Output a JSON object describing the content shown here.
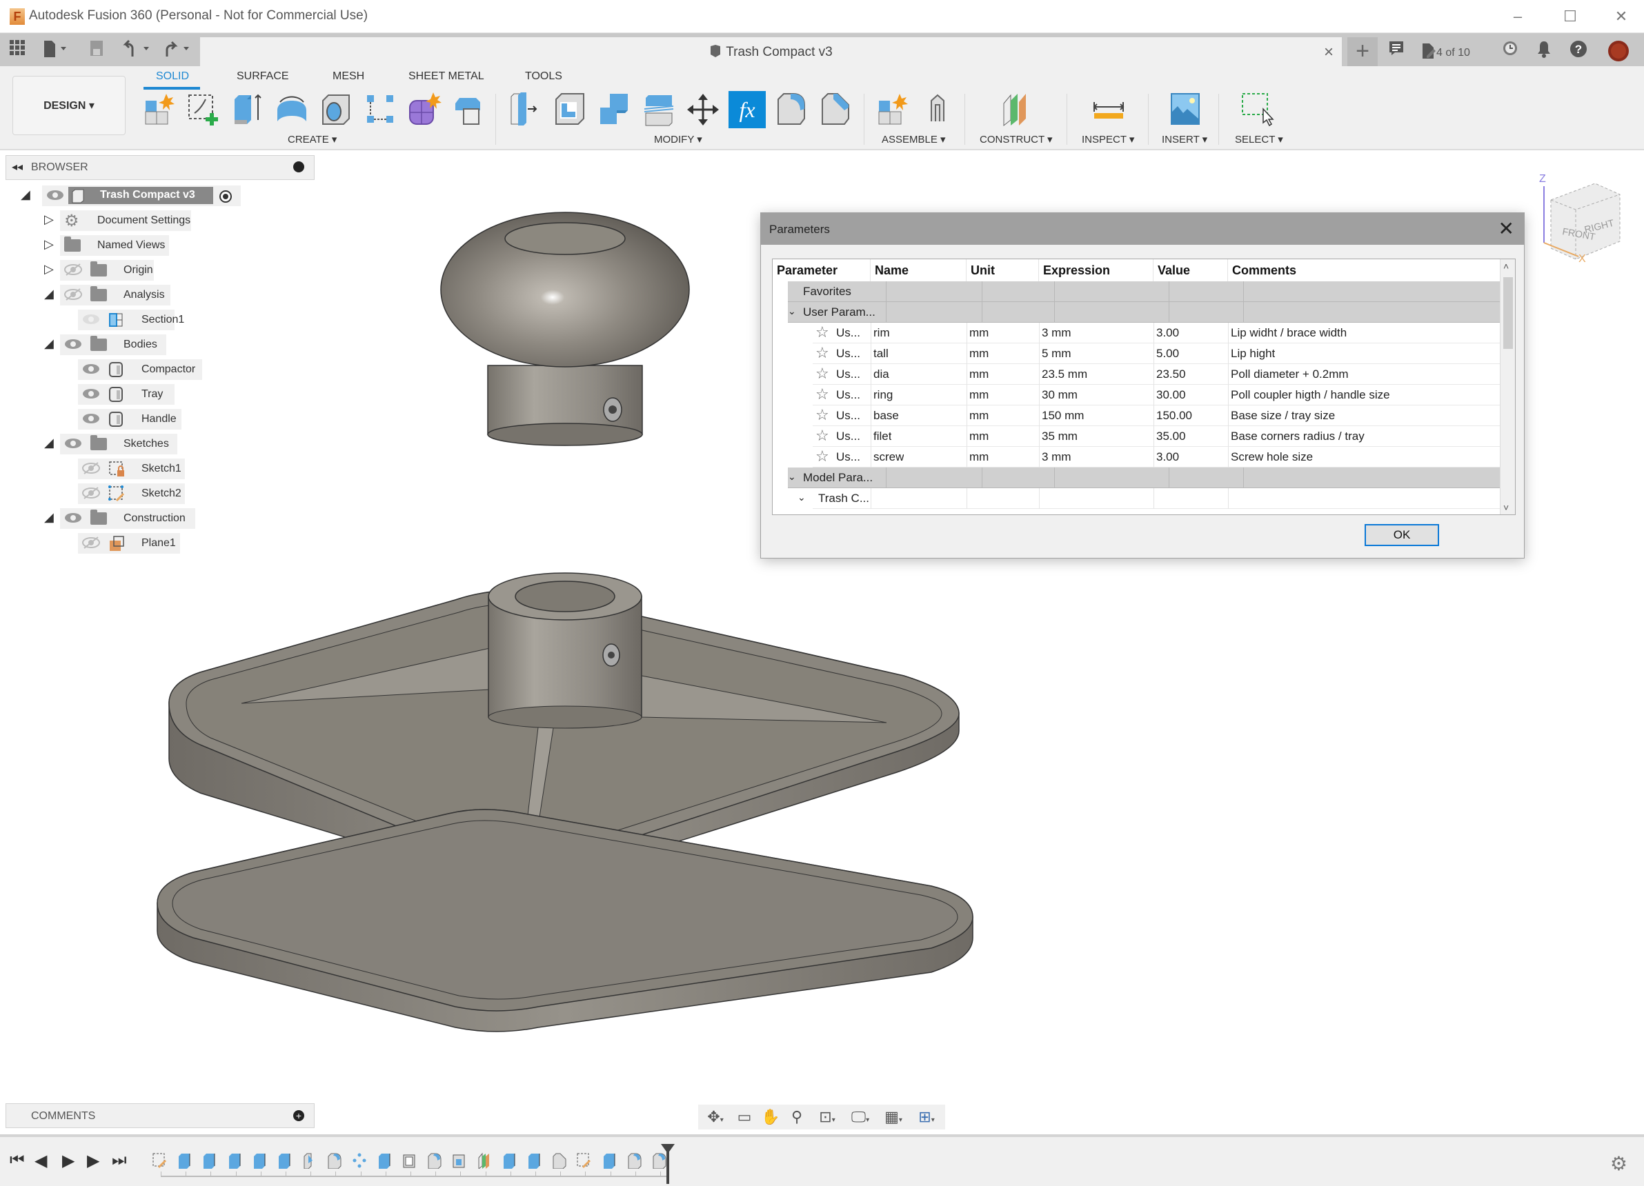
{
  "window": {
    "title": "Autodesk Fusion 360 (Personal - Not for Commercial Use)",
    "minimize": "–",
    "maximize": "☐",
    "close": "✕"
  },
  "quick_access": {
    "icons": [
      "data-panel-icon",
      "file-icon",
      "save-icon",
      "undo-icon",
      "redo-icon"
    ]
  },
  "document": {
    "title": "Trash Compact v3",
    "close": "×",
    "new_tab": "+"
  },
  "header_right": {
    "jobs_label": "4 of 10"
  },
  "ribbon": {
    "workspace": "DESIGN ▾",
    "tabs": [
      {
        "label": "SOLID",
        "active": true
      },
      {
        "label": "SURFACE",
        "active": false
      },
      {
        "label": "MESH",
        "active": false
      },
      {
        "label": "SHEET METAL",
        "active": false
      },
      {
        "label": "TOOLS",
        "active": false
      }
    ],
    "groups": {
      "create": "CREATE ▾",
      "modify": "MODIFY ▾",
      "assemble": "ASSEMBLE ▾",
      "construct": "CONSTRUCT ▾",
      "inspect": "INSPECT ▾",
      "insert": "INSERT ▾",
      "select": "SELECT ▾"
    },
    "create_tools": [
      "new-component",
      "create-sketch",
      "extrude",
      "revolve",
      "hole",
      "pattern",
      "create-form",
      "derive"
    ],
    "modify_tools": [
      "press-pull",
      "shell",
      "combine",
      "offset-face",
      "move",
      "change-parameters",
      "fillet",
      "chamfer"
    ],
    "accent": "#1e88d2"
  },
  "browser": {
    "title": "BROWSER",
    "root": "Trash Compact v3",
    "nodes": [
      {
        "label": "Document Settings"
      },
      {
        "label": "Named Views"
      },
      {
        "label": "Origin"
      },
      {
        "label": "Analysis"
      },
      {
        "label": "Section1"
      },
      {
        "label": "Bodies"
      },
      {
        "label": "Compactor"
      },
      {
        "label": "Tray"
      },
      {
        "label": "Handle"
      },
      {
        "label": "Sketches"
      },
      {
        "label": "Sketch1"
      },
      {
        "label": "Sketch2"
      },
      {
        "label": "Construction"
      },
      {
        "label": "Plane1"
      }
    ]
  },
  "comments": {
    "title": "COMMENTS"
  },
  "viewcube": {
    "front": "FRONT",
    "right": "RIGHT",
    "z_axis": "Z",
    "x_axis": "X"
  },
  "parameters_dialog": {
    "title": "Parameters",
    "close": "✕",
    "columns": [
      "Parameter",
      "Name",
      "Unit",
      "Expression",
      "Value",
      "Comments"
    ],
    "groups": {
      "favorites": "Favorites",
      "user": "User Param...",
      "model": "Model Para...",
      "model_child": "Trash C..."
    },
    "user_parameters": [
      {
        "param": "Us...",
        "name": "rim",
        "unit": "mm",
        "expression": "3 mm",
        "value": "3.00",
        "comment": "Lip widht / brace width"
      },
      {
        "param": "Us...",
        "name": "tall",
        "unit": "mm",
        "expression": "5 mm",
        "value": "5.00",
        "comment": "Lip hight"
      },
      {
        "param": "Us...",
        "name": "dia",
        "unit": "mm",
        "expression": "23.5 mm",
        "value": "23.50",
        "comment": "Poll diameter + 0.2mm"
      },
      {
        "param": "Us...",
        "name": "ring",
        "unit": "mm",
        "expression": "30 mm",
        "value": "30.00",
        "comment": "Poll coupler higth / handle size"
      },
      {
        "param": "Us...",
        "name": "base",
        "unit": "mm",
        "expression": "150 mm",
        "value": "150.00",
        "comment": "Base size / tray size"
      },
      {
        "param": "Us...",
        "name": "filet",
        "unit": "mm",
        "expression": "35 mm",
        "value": "35.00",
        "comment": "Base corners radius / tray"
      },
      {
        "param": "Us...",
        "name": "screw",
        "unit": "mm",
        "expression": "3 mm",
        "value": "3.00",
        "comment": "Screw hole size"
      }
    ],
    "ok_label": "OK"
  },
  "timeline": {
    "feature_count": 21
  }
}
